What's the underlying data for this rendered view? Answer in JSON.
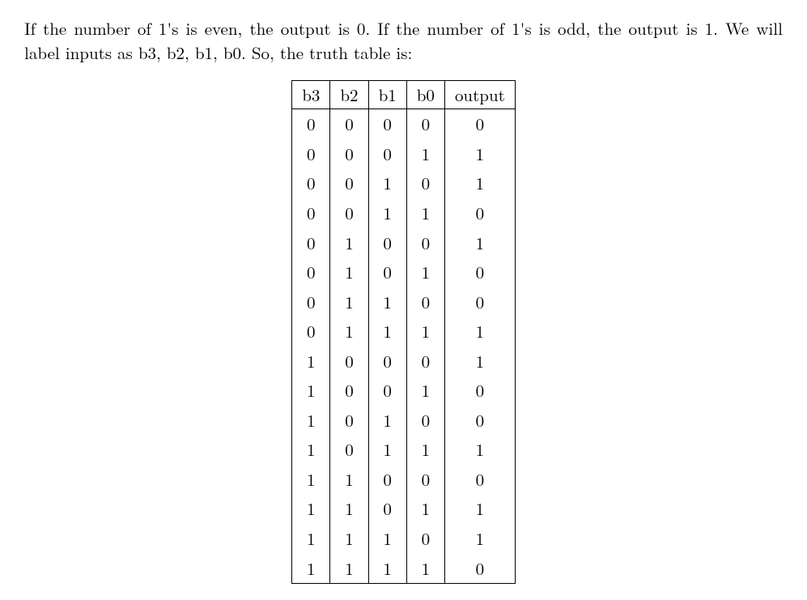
{
  "paragraph": "If the number of 1's is even, the output is 0. If the number of 1's is odd, the output is 1. We will label inputs as b3, b2, b1, b0. So, the truth table is:",
  "chart_data": {
    "type": "table",
    "columns": [
      "b3",
      "b2",
      "b1",
      "b0",
      "output"
    ],
    "rows": [
      [
        "0",
        "0",
        "0",
        "0",
        "0"
      ],
      [
        "0",
        "0",
        "0",
        "1",
        "1"
      ],
      [
        "0",
        "0",
        "1",
        "0",
        "1"
      ],
      [
        "0",
        "0",
        "1",
        "1",
        "0"
      ],
      [
        "0",
        "1",
        "0",
        "0",
        "1"
      ],
      [
        "0",
        "1",
        "0",
        "1",
        "0"
      ],
      [
        "0",
        "1",
        "1",
        "0",
        "0"
      ],
      [
        "0",
        "1",
        "1",
        "1",
        "1"
      ],
      [
        "1",
        "0",
        "0",
        "0",
        "1"
      ],
      [
        "1",
        "0",
        "0",
        "1",
        "0"
      ],
      [
        "1",
        "0",
        "1",
        "0",
        "0"
      ],
      [
        "1",
        "0",
        "1",
        "1",
        "1"
      ],
      [
        "1",
        "1",
        "0",
        "0",
        "0"
      ],
      [
        "1",
        "1",
        "0",
        "1",
        "1"
      ],
      [
        "1",
        "1",
        "1",
        "0",
        "1"
      ],
      [
        "1",
        "1",
        "1",
        "1",
        "0"
      ]
    ]
  }
}
